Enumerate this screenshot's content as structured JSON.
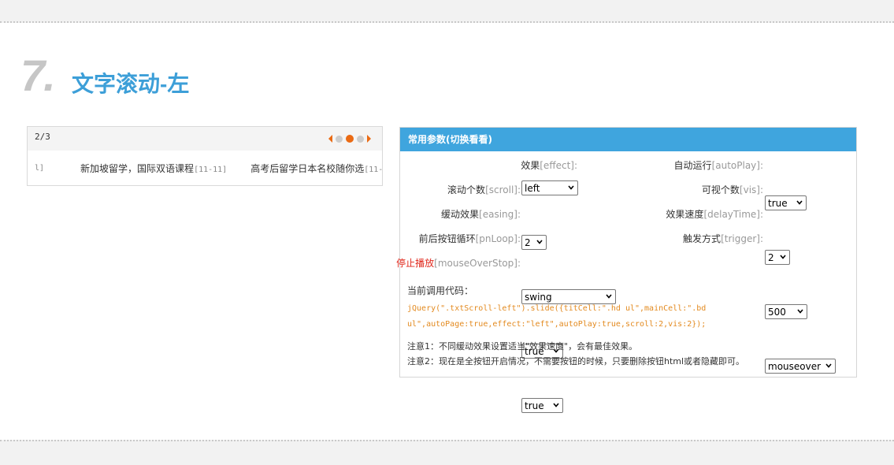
{
  "section": {
    "number": "7.",
    "title": "文字滚动-左"
  },
  "demo": {
    "page_count": "2/3",
    "pager": {
      "pages": 3,
      "active_page": 2
    },
    "items": [
      {
        "text": "",
        "date": "l]"
      },
      {
        "text": "新加坡留学，国际双语课程",
        "date": "[11-11]"
      },
      {
        "text": "高考后留学日本名校随你选",
        "date": "[11-"
      }
    ]
  },
  "params": {
    "header": "常用参数(切换看看)",
    "effect": {
      "label": "效果",
      "key": "[effect]:",
      "value": "left"
    },
    "autoPlay": {
      "label": "自动运行",
      "key": "[autoPlay]:",
      "value": "true"
    },
    "scroll": {
      "label": "滚动个数",
      "key": "[scroll]:",
      "value": "2"
    },
    "vis": {
      "label": "可视个数",
      "key": "[vis]:",
      "value": "2"
    },
    "easing": {
      "label": "缓动效果",
      "key": "[easing]:",
      "value": "swing"
    },
    "delayTime": {
      "label": "效果速度",
      "key": "[delayTime]:",
      "value": "500"
    },
    "pnLoop": {
      "label": "前后按钮循环",
      "key": "[pnLoop]:",
      "value": "true"
    },
    "trigger": {
      "label": "触发方式",
      "key": "[trigger]:",
      "value": "mouseover"
    },
    "mouseOverStop": {
      "label": "停止播放",
      "key": "[mouseOverStop]:",
      "value": "true"
    }
  },
  "code": {
    "title": "当前调用代码：",
    "text": "jQuery(\".txtScroll-left\").slide({titCell:\".hd ul\",mainCell:\".bd ul\",autoPage:true,effect:\"left\",autoPlay:true,scroll:2,vis:2});"
  },
  "notes": {
    "note1": "注意1：不同缓动效果设置适当\"效果速度\"，会有最佳效果。",
    "note2": "注意2：现在是全按钮开启情况，不需要按钮的时候，只要删除按钮html或者隐藏即可。"
  },
  "colors": {
    "accent": "#3fa5de",
    "title": "#3d9fd8",
    "pager_active": "#ea6a13",
    "code": "#e38a1f",
    "stop_label": "#e0271b"
  },
  "icons": {
    "select_arrow": "chevron-down-icon",
    "prev": "triangle-left-icon",
    "next": "triangle-right-icon"
  }
}
